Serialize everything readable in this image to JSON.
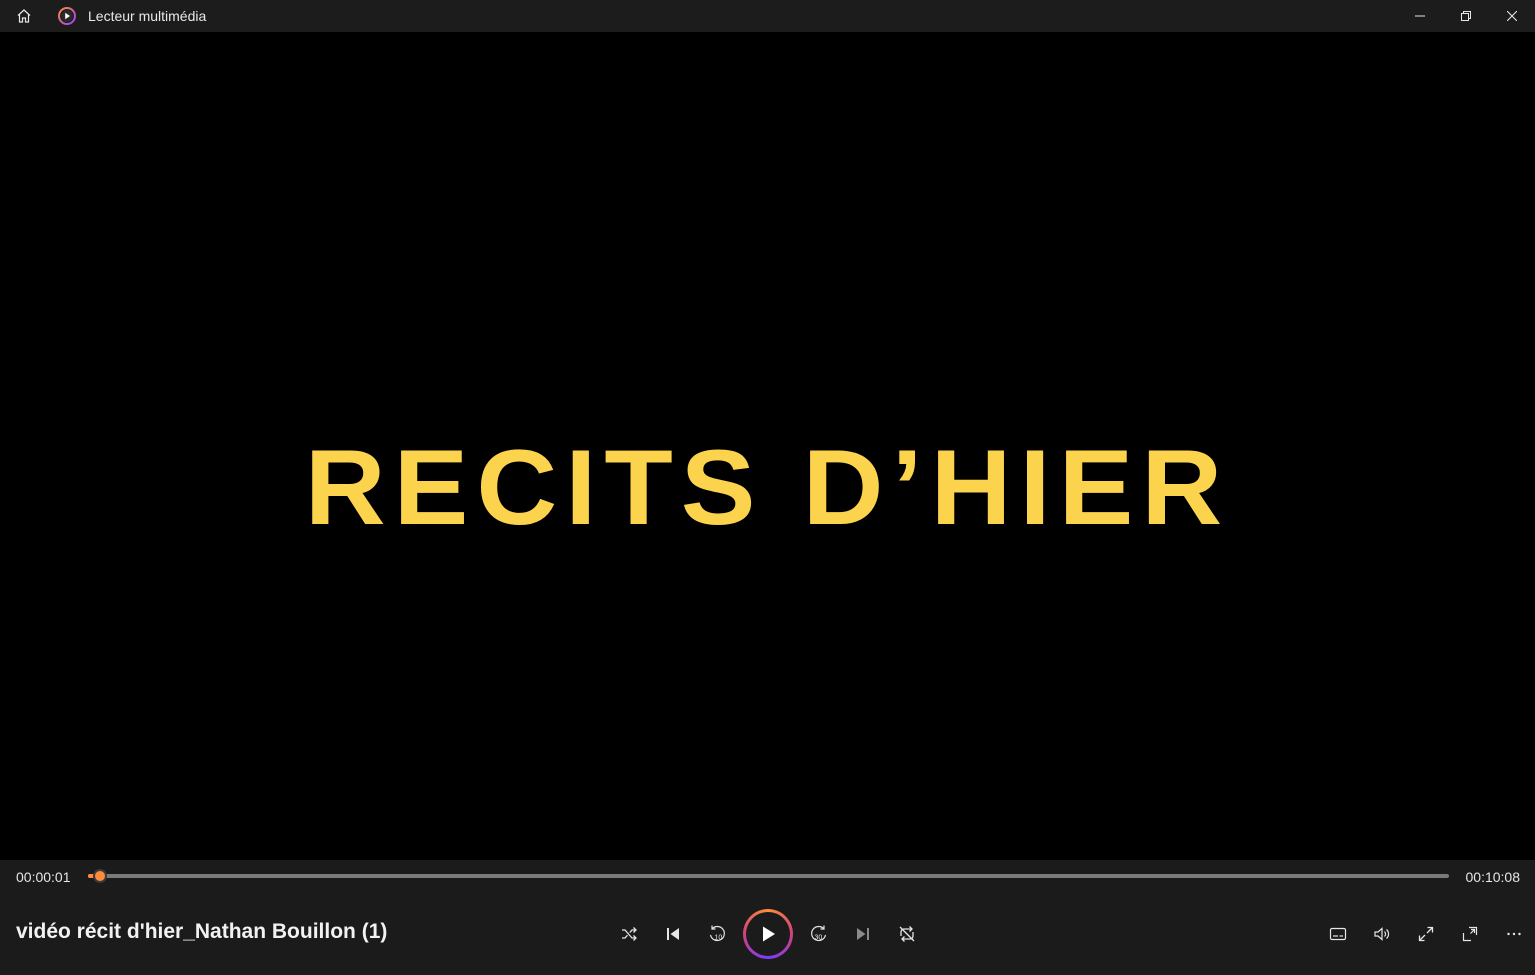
{
  "window": {
    "app_title": "Lecteur multimédia"
  },
  "video": {
    "frame_text": "RECITS D’HIER",
    "frame_text_color": "#fcd34d"
  },
  "player": {
    "current_time": "00:00:01",
    "duration": "00:10:08",
    "progress_fraction": 0.0016,
    "media_title": "vidéo récit d'hier_Nathan Bouillon (1)",
    "accent_color": "#ff8c3b",
    "skip_back_label": "10",
    "skip_forward_label": "30"
  },
  "icons": {
    "home": "home-icon",
    "app": "media-player-icon",
    "minimize": "minimize-icon",
    "restore": "restore-icon",
    "close": "close-icon",
    "shuffle": "shuffle-icon",
    "previous": "previous-icon",
    "skip_back": "skip-back-icon",
    "play": "play-icon",
    "skip_forward": "skip-forward-icon",
    "next": "next-icon",
    "repeat": "repeat-off-icon",
    "subtitles": "subtitles-icon",
    "volume": "volume-icon",
    "fullscreen": "fullscreen-icon",
    "miniplayer": "mini-player-icon",
    "more": "more-icon"
  }
}
